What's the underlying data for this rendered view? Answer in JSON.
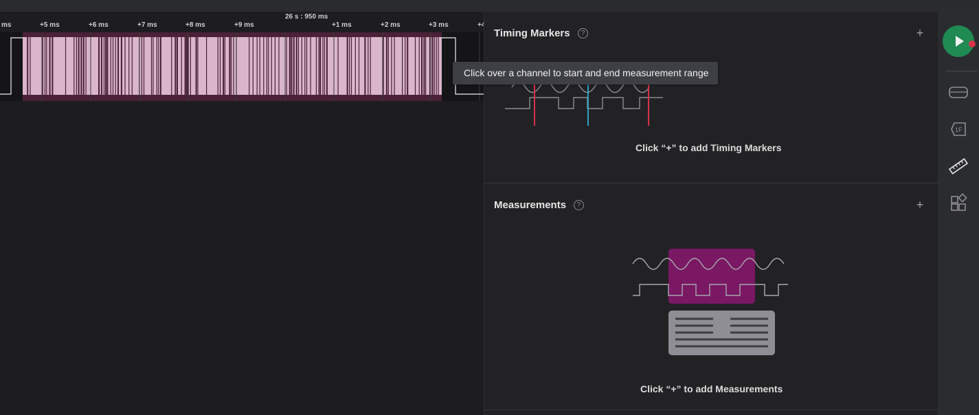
{
  "timeline": {
    "anchor_label": "26 s : 950 ms",
    "ticks": [
      "ms",
      "+5 ms",
      "+6 ms",
      "+7 ms",
      "+8 ms",
      "+9 ms",
      "+1 ms",
      "+2 ms",
      "+3 ms",
      "+4"
    ]
  },
  "channel": {
    "highlight_color": "#d9b6ca",
    "region_color": "#4a2136",
    "line_color": "#4a1f35"
  },
  "tooltip": {
    "text": "Click over a channel to start and end measurement range"
  },
  "timing_markers": {
    "title": "Timing Markers",
    "help": "?",
    "add": "+",
    "empty_text": "Click “+” to add Timing Markers"
  },
  "measurements": {
    "title": "Measurements",
    "help": "?",
    "add": "+",
    "empty_text": "Click “+” to add Measurements"
  },
  "sidebar": {
    "run_color": "#1f8a52",
    "record_dot_color": "#d8324a",
    "icons": [
      "analyzers-icon",
      "protocol-decoder-icon",
      "measure-ruler-icon",
      "extensions-icon"
    ]
  }
}
